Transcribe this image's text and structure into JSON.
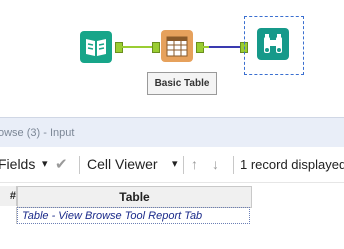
{
  "canvas": {
    "tool_label": "Basic Table",
    "colors": {
      "input_tool": "#1aa68a",
      "table_tool": "#e8a25a",
      "browse_tool": "#1a9e8c",
      "connector": "#3a3ab0",
      "anchor": "#9acd32"
    }
  },
  "panel": {
    "title": "owse (3) - Input"
  },
  "toolbar": {
    "fields_label": "Fields",
    "fields_dropdown": "▾",
    "check_icon": "✔",
    "cell_viewer_label": "Cell Viewer",
    "cell_viewer_dropdown": "▾",
    "up_arrow": "↑",
    "down_arrow": "↓",
    "record_status": "1 record displayed"
  },
  "grid": {
    "row_header": "#",
    "columns": [
      "Table"
    ],
    "rows": [
      [
        "Table - View Browse Tool Report Tab"
      ]
    ]
  }
}
